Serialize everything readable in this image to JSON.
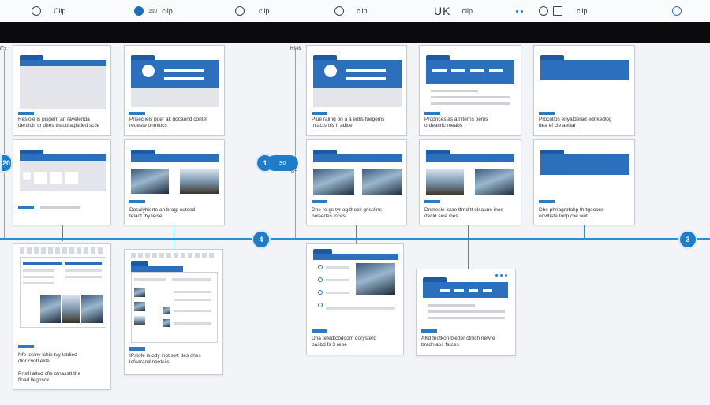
{
  "toolbar": {
    "items": [
      {
        "icon": "clock-icon",
        "label": "Clip"
      },
      {
        "icon": "record-dot-icon",
        "prefix": "1s0",
        "label": "clip"
      },
      {
        "icon": "face-icon",
        "label": "clip"
      },
      {
        "icon": "timer-icon",
        "label": "clip"
      },
      {
        "icon": "text-icon",
        "prefix": "UK",
        "label": "clip"
      },
      {
        "icon": "edit-icon",
        "label": "clip"
      }
    ]
  },
  "left_labels": {
    "top": "Cz.",
    "node": "20",
    "sub": "2."
  },
  "mid_labels": {
    "top": "Rses",
    "sub": "3~"
  },
  "nodes": {
    "n1": "1",
    "pill": "S0",
    "n4": "4",
    "n3": "3"
  },
  "cards": [
    {
      "lines": [
        "Reslole is pisgern an ravelenda",
        "dertticls cr dhes thaod aglatied sctle"
      ]
    },
    {
      "lines": [
        "Prisecliels pder ak ddcaond contet",
        "redeste onmiocs"
      ]
    },
    {
      "lines": [
        "Plue raling on a a edlis fuegems",
        "lntacts ols h adice"
      ]
    },
    {
      "lines": [
        "Proprices as atniterns penis",
        "ordeacric meabs"
      ]
    },
    {
      "lines": [
        "Procollos enyalderad edrikedlog",
        "dea ef cle aedar"
      ]
    },
    {
      "lines": [
        ""
      ]
    },
    {
      "lines": [
        "Dosalyhierte an bragt outsed",
        "teladt thy leise"
      ]
    },
    {
      "lines": [
        "Dhe re gs tyr ag thock grisslins",
        "helsedes lnces"
      ]
    },
    {
      "lines": [
        "Dnmesle lstae tfrnd tt elsaune ines",
        "decld sice ines"
      ]
    },
    {
      "lines": [
        "Dhe phriagrbtahp thrtgeoore",
        "odwtiste tonp clie wet"
      ]
    },
    {
      "lines": [
        "Nfe lesiny lchie tvy latdied",
        "dlor cvotl elite."
      ],
      "extra": [
        "Pnstll alted cfie ofnasstt the",
        "fioad llegnsck."
      ]
    },
    {
      "lines": [
        "IPslofe is ody inotisett des ches",
        "lofcarand nbetsiis"
      ]
    },
    {
      "lines": [
        "Dha tefedtcbdoom dorysterd",
        "basbd fs 3 repe"
      ]
    },
    {
      "lines": [
        "AKd fnotkon bletter ctnich newre",
        "bradhlaos fatces"
      ]
    }
  ]
}
